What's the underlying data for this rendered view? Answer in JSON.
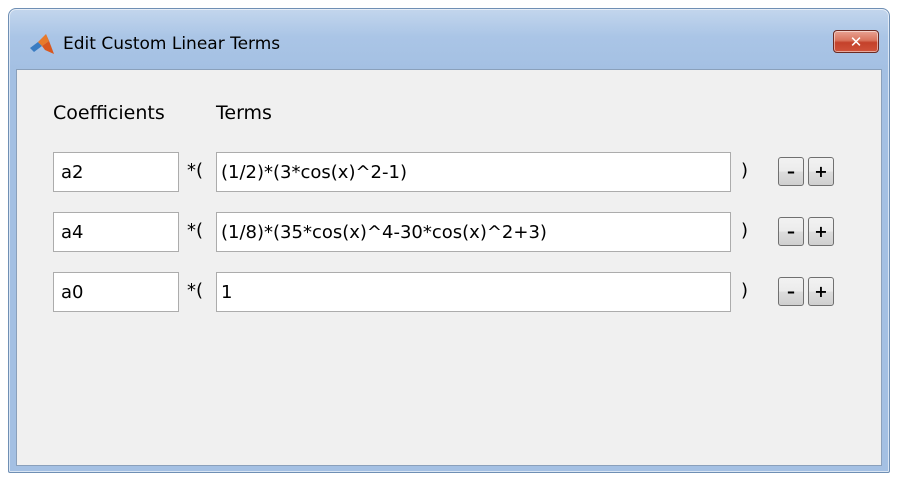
{
  "window": {
    "title": "Edit Custom Linear Terms",
    "close_label": "✕"
  },
  "headers": {
    "coefficients": "Coefficients",
    "terms": "Terms"
  },
  "rows": [
    {
      "coefficient": "a2",
      "open": "*(",
      "term": "(1/2)*(3*cos(x)^2-1)",
      "close": ")",
      "remove_label": "–",
      "add_label": "+"
    },
    {
      "coefficient": "a4",
      "open": "*(",
      "term": "(1/8)*(35*cos(x)^4-30*cos(x)^2+3)",
      "close": ")",
      "remove_label": "–",
      "add_label": "+"
    },
    {
      "coefficient": "a0",
      "open": "*(",
      "term": "1",
      "close": ")",
      "remove_label": "–",
      "add_label": "+"
    }
  ]
}
